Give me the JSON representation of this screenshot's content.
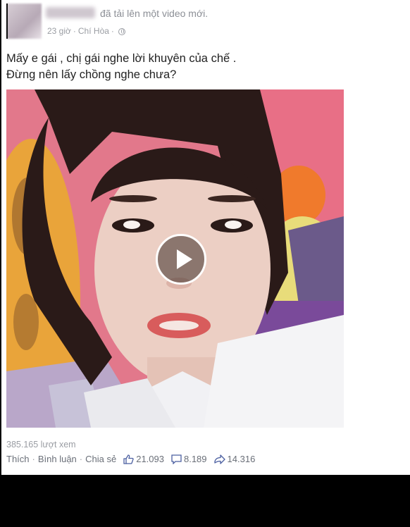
{
  "post": {
    "action_text": "đã tải lên một video mới.",
    "time": "23 giờ",
    "location": "Chí Hòa",
    "text_line1": "Mấy e gái , chị gái nghe lời khuyên của chế .",
    "text_line2": "Đừng nên lấy chồng nghe chưa?",
    "views": "385.165 lượt xem"
  },
  "actions": {
    "like": "Thích",
    "comment": "Bình luận",
    "share": "Chia sẻ",
    "like_count": "21.093",
    "comment_count": "8.189",
    "share_count": "14.316"
  },
  "icons": {
    "like": "thumbs-up-icon",
    "comment": "speech-bubble-icon",
    "share": "share-arrow-icon",
    "privacy": "globe-icon",
    "play": "play-icon"
  },
  "colors": {
    "meta_text": "#9a9da3",
    "body_text": "#222222",
    "background": "#ffffff"
  }
}
